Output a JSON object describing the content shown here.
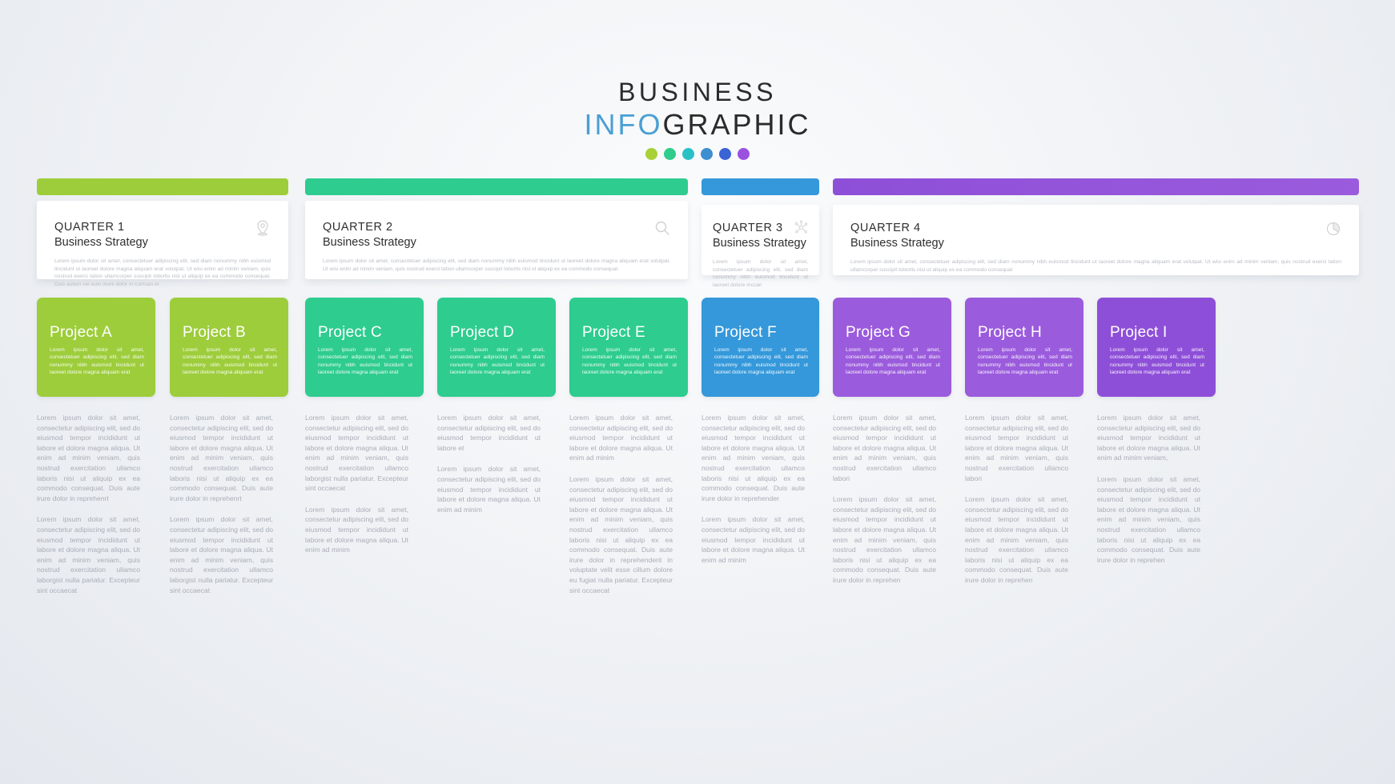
{
  "title": {
    "line1": "BUSINESS",
    "line2_accent": "INFO",
    "line2_rest": "GRAPHIC",
    "dot_colors": [
      "#a8d037",
      "#2fcc8b",
      "#29c1c6",
      "#3e8fd0",
      "#3a63d6",
      "#9b51e0"
    ]
  },
  "colors": {
    "green": "#9dcd3b",
    "teal": "#2ecc8f",
    "blue": "#3498db",
    "purple": "#8e4fd8",
    "purple_light": "#9b5bdd"
  },
  "lorem": {
    "quarter_body": "Lorem ipsum dolor sit amet, consectetuer adipiscing elit, sed diam nonummy nibh euismod tincidunt ut laoreet dolore magna aliquam erat volutpat. Ut wisi enim ad minim veniam, quis nostrud exerci tation ullamcorper suscipit lobortis nisl ut aliquip ex ea commodo consequat. Duis autem vel eum iriure dolor in cumsan et",
    "quarter_body_short": "Lorem ipsum dolor sit amet, consectetuer adipiscing elit, sed diam nonummy nibh euismod tincidunt ut laoreet dolore magna aliquam erat volutpat. Ut wisi enim ad minim veniam, quis nostrud exerci tation ullamcorper suscipit lobortis nisl ut aliquip ex ea commodo consequat",
    "quarter_body_tiny": "Lorem ipsum dolor sit amet, consectetuer adipiscing elit, sed diam nonummy nibh euismod tincidunt ut laoreet dolore mccan",
    "project_body": "Lorem ipsum dolor sit amet, consectetuer adipiscing elit, sed diam nonummy nibh euismod tincidunt ut laoreet dolore magna aliquam erat",
    "col_p1": "Lorem ipsum dolor sit amet, consectetur adipiscing elit, sed do eiusmod tempor incididunt ut labore et dolore magna aliqua. Ut enim ad minim veniam, quis nostrud exercitation ullamco laboris nisi ut aliquip ex ea commodo consequat. Duis aute irure dolor in reprehenrt",
    "col_p2": "Lorem ipsum dolor sit amet, consectetur adipiscing elit, sed do eiusmod tempor incididunt ut labore et dolore magna aliqua. Ut enim ad minim veniam, quis nostrud exercitation ullamco laborgist nulla pariatur. Excepteur sint occaecat",
    "col_c_p1": "Lorem ipsum dolor sit amet, consectetur adipiscing elit, sed do eiusmod tempor incididunt ut labore et dolore magna aliqua. Ut enim ad minim veniam, quis nostrud exercitation ullamco laborgist nulla pariatur. Excepteur sint occaecat",
    "col_c_p2": "Lorem ipsum dolor sit amet, consectetur adipiscing elit, sed do eiusmod tempor incididunt ut labore et dolore magna aliqua. Ut enim ad minim",
    "col_d_p1": "Lorem ipsum dolor sit amet, consectetur adipiscing elit, sed do eiusmod tempor incididunt ut labore et",
    "col_d_p2": "Lorem ipsum dolor sit amet, consectetur adipiscing elit, sed do eiusmod tempor incididunt ut labore et dolore magna aliqua. Ut enim ad minim",
    "col_e_p1": "Lorem ipsum dolor sit amet, consectetur adipiscing elit, sed do eiusmod tempor incididunt ut labore et dolore magna aliqua. Ut enim ad minim",
    "col_e_p2": "Lorem ipsum dolor sit amet, consectetur adipiscing elit, sed do eiusmod tempor incididunt ut labore et dolore magna aliqua. Ut enim ad minim veniam, quis nostrud exercitation ullamco laboris nisi ut aliquip ex ea commodo consequat. Duis aute irure dolor in reprehenderit in voluptate velit esse cillum dolore eu fugiat nulla pariatur. Excepteur sint occaecat",
    "col_f_p1": "Lorem ipsum dolor sit amet, consectetur adipiscing elit, sed do eiusmod tempor incididunt ut labore et dolore magna aliqua. Ut enim ad minim veniam, quis nostrud exercitation ullamco laboris nisi ut aliquip ex ea commodo consequat. Duis aute irure dolor in reprehender",
    "col_f_p2": "Lorem ipsum dolor sit amet, consectetur adipiscing elit, sed do eiusmod tempor incididunt ut labore et dolore magna aliqua. Ut enim ad minim",
    "col_g_p1": "Lorem ipsum dolor sit amet, consectetur adipiscing elit, sed do eiusmod tempor incididunt ut labore et dolore magna aliqua. Ut enim ad minim veniam, quis nostrud exercitation ullamco labori",
    "col_g_p2": "Lorem ipsum dolor sit amet, consectetur adipiscing elit, sed do eiusmod tempor incididunt ut labore et dolore magna aliqua. Ut enim ad minim veniam, quis nostrud exercitation ullamco laboris nisi ut aliquip ex ea commodo consequat. Duis aute irure dolor in reprehen",
    "col_h_p1": "Lorem ipsum dolor sit amet, consectetur adipiscing elit, sed do eiusmod tempor incididunt ut labore et dolore magna aliqua. Ut enim ad minim veniam, quis nostrud exercitation ullamco labori",
    "col_h_p2": "Lorem ipsum dolor sit amet, consectetur adipiscing elit, sed do eiusmod tempor incididunt ut labore et dolore magna aliqua. Ut enim ad minim veniam, quis nostrud exercitation ullamco laboris nisi ut aliquip ex ea commodo consequat. Duis aute irure dolor in reprehen",
    "col_i_p1": "Lorem ipsum dolor sit amet, consectetur adipiscing elit, sed do eiusmod tempor incididunt ut labore et dolore magna aliqua. Ut enim ad minim veniam,",
    "col_i_p2": "Lorem ipsum dolor sit amet, consectetur adipiscing elit, sed do eiusmod tempor incididunt ut labore et dolore magna aliqua. Ut enim ad minim veniam, quis nostrud exercitation ullamco laboris nisi ut aliquip ex ea commodo consequat. Duis aute irure dolor in reprehen"
  },
  "quarters": [
    {
      "head": "QUARTER 1",
      "sub": "Business Strategy",
      "icon": "location-pin-icon"
    },
    {
      "head": "QUARTER 2",
      "sub": "Business Strategy",
      "icon": "search-icon"
    },
    {
      "head": "QUARTER 3",
      "sub": "Business Strategy",
      "icon": "network-nodes-icon"
    },
    {
      "head": "QUARTER 4",
      "sub": "Business Strategy",
      "icon": "pie-chart-icon"
    }
  ],
  "projects": [
    {
      "title": "Project A",
      "color": "#9dcd3b"
    },
    {
      "title": "Project B",
      "color": "#9dcd3b"
    },
    {
      "title": "Project C",
      "color": "#2ecc8f"
    },
    {
      "title": "Project D",
      "color": "#2ecc8f"
    },
    {
      "title": "Project E",
      "color": "#2ecc8f"
    },
    {
      "title": "Project F",
      "color": "#3498db"
    },
    {
      "title": "Project G",
      "color": "#9b5bdd"
    },
    {
      "title": "Project H",
      "color": "#9b5bdd"
    },
    {
      "title": "Project I",
      "color": "#8e4fd8"
    }
  ]
}
